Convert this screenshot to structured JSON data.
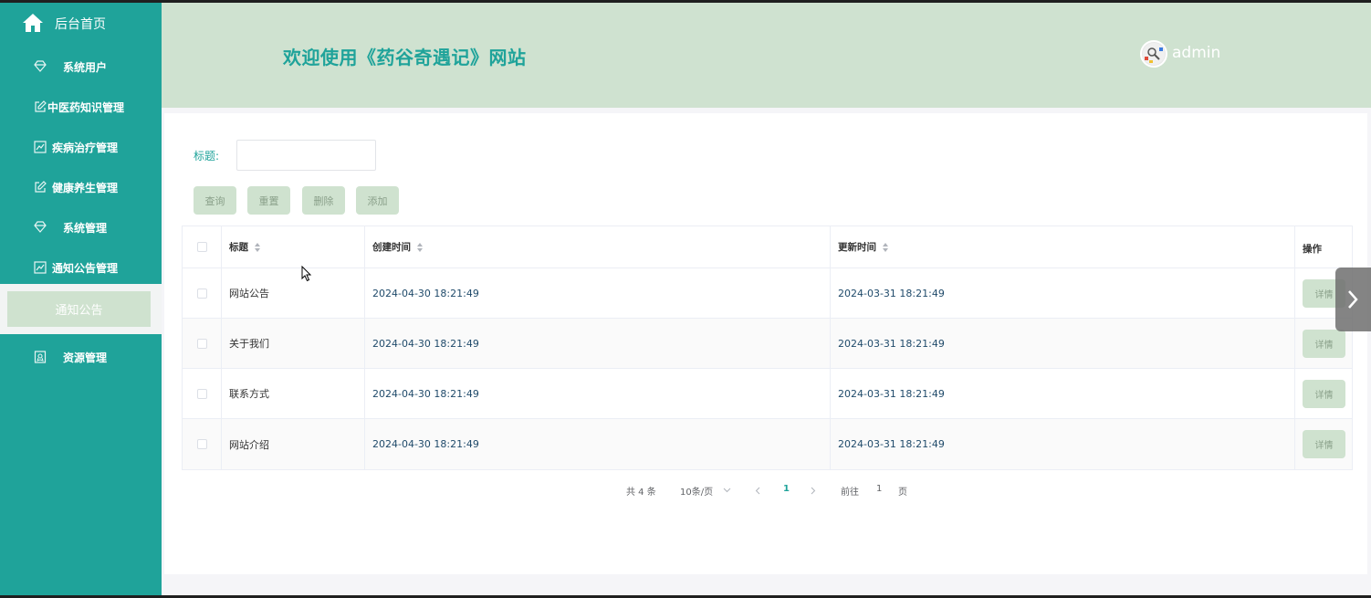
{
  "sidebar": {
    "home_label": "后台首页",
    "items": [
      {
        "label": "系统用户",
        "icon": "diamond-icon"
      },
      {
        "label": "中医药知识管理",
        "icon": "edit-icon"
      },
      {
        "label": "疾病治疗管理",
        "icon": "chart-icon"
      },
      {
        "label": "健康养生管理",
        "icon": "edit-icon"
      },
      {
        "label": "系统管理",
        "icon": "diamond-icon"
      },
      {
        "label": "通知公告管理",
        "icon": "chart-icon"
      },
      {
        "label": "资源管理",
        "icon": "badge-icon"
      }
    ],
    "submenu_active": "通知公告"
  },
  "header": {
    "title": "欢迎使用《药谷奇遇记》网站",
    "username": "admin"
  },
  "search": {
    "label": "标题:",
    "value": "",
    "placeholder": ""
  },
  "toolbar": {
    "query_label": "查询",
    "reset_label": "重置",
    "delete_label": "删除",
    "add_label": "添加"
  },
  "table": {
    "headers": {
      "title": "标题",
      "created": "创建时间",
      "updated": "更新时间",
      "operation": "操作"
    },
    "rows": [
      {
        "title": "网站公告",
        "created": "2024-04-30 18:21:49",
        "updated": "2024-03-31 18:21:49",
        "action": "详情"
      },
      {
        "title": "关于我们",
        "created": "2024-04-30 18:21:49",
        "updated": "2024-03-31 18:21:49",
        "action": "详情"
      },
      {
        "title": "联系方式",
        "created": "2024-04-30 18:21:49",
        "updated": "2024-03-31 18:21:49",
        "action": "详情"
      },
      {
        "title": "网站介绍",
        "created": "2024-04-30 18:21:49",
        "updated": "2024-03-31 18:21:49",
        "action": "详情"
      }
    ]
  },
  "pagination": {
    "total": "共 4 条",
    "page_size": "10条/页",
    "current_page": "1",
    "goto_prefix": "前往",
    "goto_value": "1",
    "goto_suffix": "页"
  },
  "colors": {
    "accent": "#1fa39a",
    "header_bg": "#cfe2d0",
    "button_bg": "#cfe2cf"
  }
}
